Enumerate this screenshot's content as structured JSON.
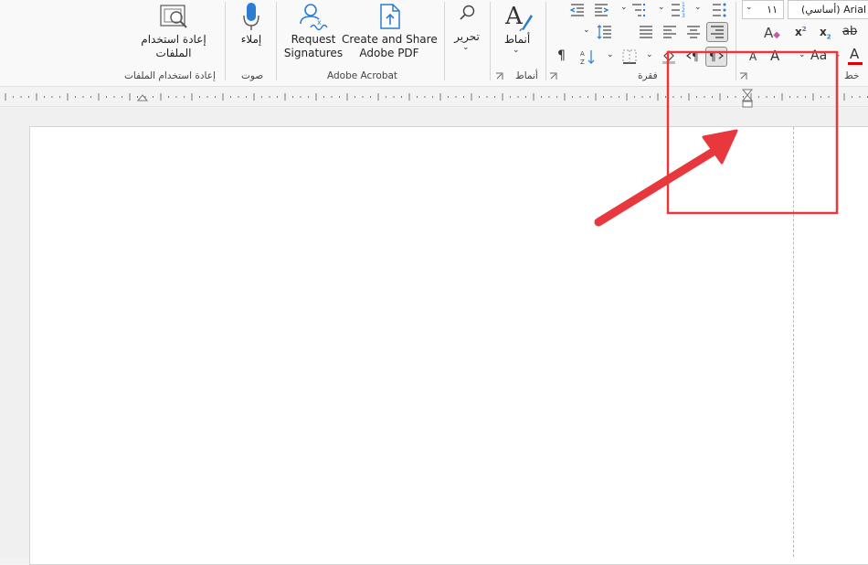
{
  "ribbon": {
    "reuse_files": {
      "button_label": "إعادة استخدام الملفات",
      "group_label": "إعادة استخدام الملفات"
    },
    "voice": {
      "button_label": "إملاء",
      "group_label": "صوت"
    },
    "acrobat": {
      "request_line1": "Request",
      "request_line2": "Signatures",
      "create_line1": "Create and Share",
      "create_line2": "Adobe PDF",
      "group_label": "Adobe Acrobat"
    },
    "editing": {
      "button_label": "تحرير"
    },
    "styles": {
      "button_label": "أنماط",
      "group_label": "أنماط"
    },
    "paragraph": {
      "group_label": "فقرة"
    },
    "font": {
      "group_label": "خط",
      "font_name": "Arial (أساسي)",
      "font_size": "١١",
      "grow_font": "A",
      "shrink_font": "A",
      "change_case": "Aa",
      "font_color": "A"
    }
  },
  "colors": {
    "annotation_red": "#e8383d",
    "accent_blue": "#2b7cd3",
    "font_color_bar": "#e00000"
  },
  "annotation": {
    "shapes": [
      "highlight-rectangle",
      "arrow"
    ]
  }
}
